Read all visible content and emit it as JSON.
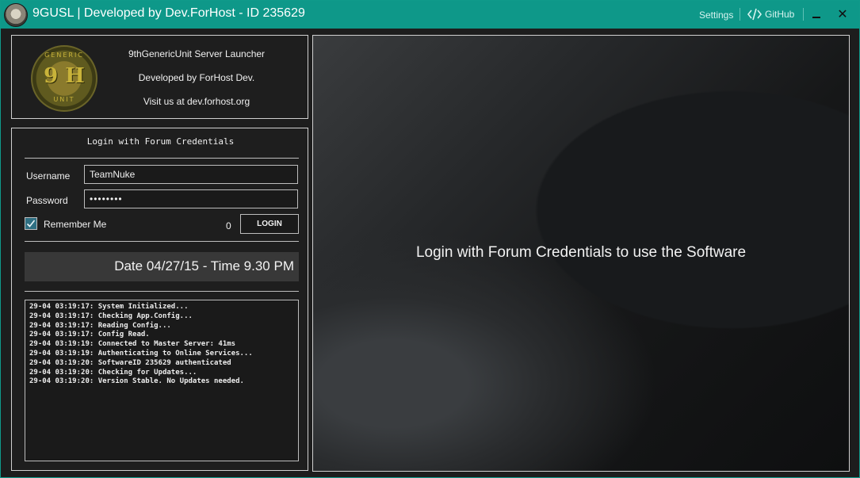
{
  "window": {
    "title": "9GUSL | Developed by Dev.ForHost - ID 235629",
    "settings_label": "Settings",
    "github_label": "GitHub"
  },
  "header": {
    "logo_top_text": "GENERIC",
    "logo_main_text": "9 H",
    "logo_bottom_text": "UNIT",
    "line1": "9thGenericUnit Server Launcher",
    "line2": "Developed by ForHost Dev.",
    "line3": "Visit us at dev.forhost.org"
  },
  "login": {
    "heading": "Login with Forum Credentials",
    "username_label": "Username",
    "username_value": "TeamNuke",
    "password_label": "Password",
    "password_value": "••••••••",
    "remember_label": "Remember Me",
    "remember_checked": true,
    "counter": "0",
    "login_button": "LOGIN"
  },
  "datetime": "Date 04/27/15 - Time 9.30 PM",
  "log": [
    "29-04 03:19:17: System Initialized...",
    "29-04 03:19:17: Checking App.Config...",
    "29-04 03:19:17: Reading Config...",
    "29-04 03:19:17: Config Read.",
    "29-04 03:19:19: Connected to Master Server: 41ms",
    "29-04 03:19:19: Authenticating to Online Services...",
    "29-04 03:19:20: SoftwareID 235629 authenticated",
    "29-04 03:19:20: Checking for Updates...",
    "29-04 03:19:20: Version Stable. No Updates needed."
  ],
  "main": {
    "message": "Login with Forum Credentials to use the Software"
  },
  "colors": {
    "titlebar": "#0e9889",
    "checkbox": "#2f6f82"
  }
}
